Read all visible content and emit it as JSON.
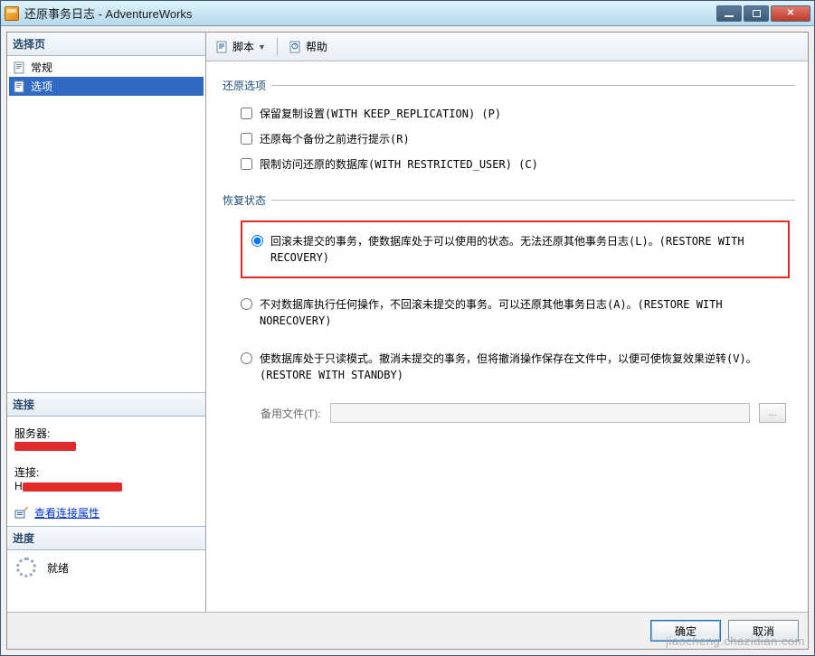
{
  "window": {
    "title": "还原事务日志 - AdventureWorks"
  },
  "sidebar": {
    "header": "选择页",
    "items": [
      {
        "label": "常规"
      },
      {
        "label": "选项"
      }
    ],
    "selected_index": 1
  },
  "connection": {
    "header": "连接",
    "server_label": "服务器:",
    "conn_label": "连接:",
    "link_text": "查看连接属性"
  },
  "progress": {
    "header": "进度",
    "status": "就绪"
  },
  "toolbar": {
    "script_label": "脚本",
    "help_label": "帮助"
  },
  "form": {
    "restore_options": {
      "legend": "还原选项",
      "keep_replication": "保留复制设置(WITH KEEP_REPLICATION) (P)",
      "prompt_before": "还原每个备份之前进行提示(R)",
      "restrict_access": "限制访问还原的数据库(WITH RESTRICTED_USER) (C)"
    },
    "recovery_state": {
      "legend": "恢复状态",
      "with_recovery": "回滚未提交的事务，使数据库处于可以使用的状态。无法还原其他事务日志(L)。(RESTORE WITH RECOVERY)",
      "with_norecovery": "不对数据库执行任何操作，不回滚未提交的事务。可以还原其他事务日志(A)。(RESTORE WITH NORECOVERY)",
      "with_standby": "使数据库处于只读模式。撤消未提交的事务，但将撤消操作保存在文件中，以便可使恢复效果逆转(V)。(RESTORE WITH STANDBY)",
      "standby_file_label": "备用文件(T):"
    }
  },
  "footer": {
    "ok": "确定",
    "cancel": "取消"
  },
  "watermark": "jiaocheng.chazidian.com"
}
